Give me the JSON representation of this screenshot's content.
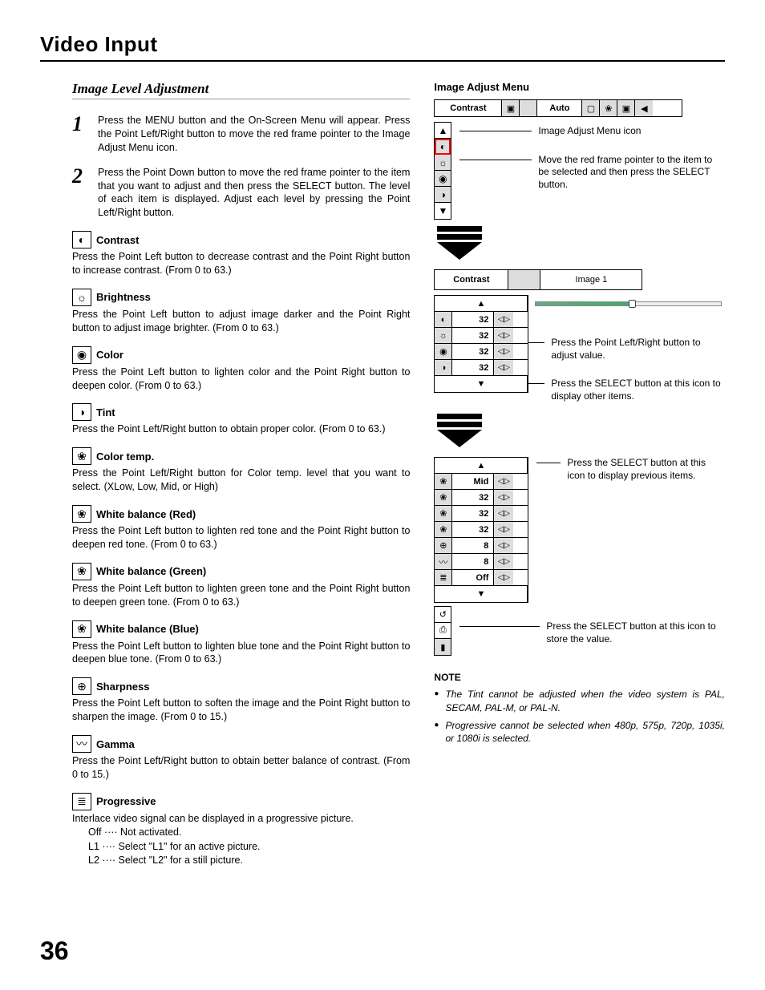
{
  "page": {
    "title": "Video Input",
    "section": "Image Level Adjustment",
    "number": "36"
  },
  "steps": [
    {
      "n": "1",
      "text": "Press the MENU button and the On-Screen Menu will appear. Press the Point Left/Right button to move the red frame pointer to the Image Adjust Menu icon."
    },
    {
      "n": "2",
      "text": "Press the Point Down button to move the red frame pointer to the item that you want to adjust and then press the SELECT button.  The level of each item is displayed.  Adjust each level by pressing the Point Left/Right button."
    }
  ],
  "adjustments": [
    {
      "icon": "◐",
      "title": "Contrast",
      "desc": "Press the Point Left button to decrease contrast and the Point Right button to increase contrast.  (From 0 to 63.)"
    },
    {
      "icon": "☼",
      "title": "Brightness",
      "desc": "Press the Point Left button to adjust image darker and the Point Right button to adjust image brighter.  (From 0 to 63.)"
    },
    {
      "icon": "◉",
      "title": "Color",
      "desc": "Press the Point Left button to lighten color and the Point Right button to deepen color.  (From 0 to 63.)"
    },
    {
      "icon": "◑",
      "title": "Tint",
      "desc": "Press the Point Left/Right button to obtain proper color.  (From 0 to 63.)"
    },
    {
      "icon": "❀",
      "title": "Color temp.",
      "desc": "Press the Point Left/Right button for Color temp. level that you want to select. (XLow, Low, Mid, or High)"
    },
    {
      "icon": "❀",
      "title": "White balance (Red)",
      "desc": "Press the Point Left button to lighten red tone and the Point Right button to deepen red tone.  (From 0 to 63.)"
    },
    {
      "icon": "❀",
      "title": "White balance (Green)",
      "desc": "Press the Point Left button to lighten green tone and the Point Right button to deepen green tone.  (From 0 to 63.)"
    },
    {
      "icon": "❀",
      "title": "White balance (Blue)",
      "desc": "Press the Point Left button to lighten blue tone and the Point Right button to deepen blue tone.  (From 0 to 63.)"
    },
    {
      "icon": "⊕",
      "title": "Sharpness",
      "desc": "Press the Point Left button to soften the image and the Point Right button to sharpen the image.  (From 0 to 15.)"
    },
    {
      "icon": "〰",
      "title": "Gamma",
      "desc": "Press the Point Left/Right button to obtain better balance of contrast. (From 0 to 15.)"
    },
    {
      "icon": "≣",
      "title": "Progressive",
      "desc": "Interlace video signal can be displayed in a progressive picture."
    }
  ],
  "progressive_modes": [
    "Off ···· Not activated.",
    "L1  ···· Select \"L1\" for an active picture.",
    "L2  ···· Select \"L2\" for a still picture."
  ],
  "figure": {
    "title": "Image Adjust Menu",
    "menubar_main": "Contrast",
    "menubar_mode": "Auto",
    "callouts": {
      "icon": "Image Adjust Menu icon",
      "pointer": "Move the red frame pointer to the item to be selected and then press the SELECT button.",
      "adjust": "Press the Point Left/Right button to adjust value.",
      "other": "Press the SELECT button at this icon to display other items.",
      "prev": "Press the SELECT button at this icon to display previous items.",
      "store": "Press the SELECT button at this icon to store the value."
    },
    "panel2": {
      "head_a": "Contrast",
      "head_b": "Image 1",
      "rows_a": [
        "32",
        "32",
        "32",
        "32"
      ]
    },
    "panel3": {
      "rows": [
        "Mid",
        "32",
        "32",
        "32",
        "8",
        "8",
        "Off"
      ]
    }
  },
  "notes": {
    "head": "NOTE",
    "items": [
      "The Tint cannot be adjusted when the video system is PAL, SECAM, PAL-M, or PAL-N.",
      "Progressive cannot be selected when 480p, 575p, 720p, 1035i, or 1080i  is selected."
    ]
  }
}
